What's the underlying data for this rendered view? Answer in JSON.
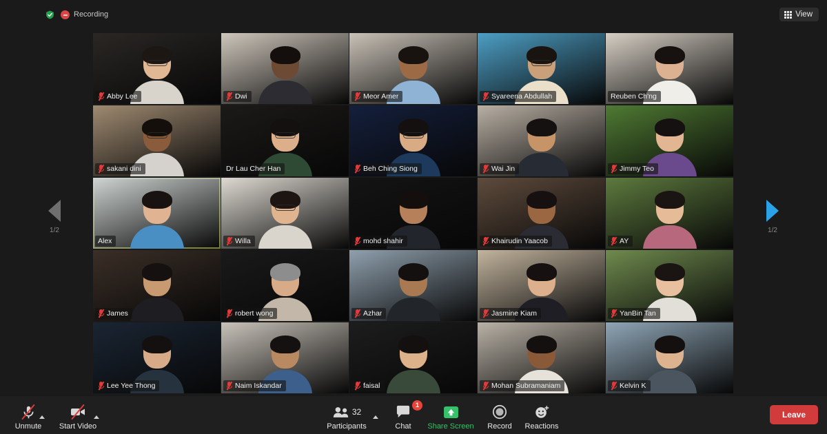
{
  "topbar": {
    "encryption_icon": "shield-check-icon",
    "encryption_color": "#22a04a",
    "recording_icon": "recording-stop-icon",
    "recording_label": "Recording",
    "view_icon": "grid-view-icon",
    "view_label": "View"
  },
  "pagination": {
    "prev_icon": "chevron-left-icon",
    "next_icon": "chevron-right-icon",
    "prev_label": "1/2",
    "next_label": "1/2",
    "prev_color": "#6e6e6e",
    "next_color": "#2ba2e8"
  },
  "gallery": {
    "columns": 5,
    "rows": 5,
    "active_speaker_color": "#d9e65a",
    "participants": [
      {
        "name": "Abby Lee",
        "muted": true,
        "speaking": false,
        "bg": "#2a2724",
        "skin": "#e0b894",
        "hair": "#1d1713",
        "shirt": "#d8d3cb",
        "glasses": true
      },
      {
        "name": "Dwi",
        "muted": true,
        "speaking": false,
        "bg": "#cfc7bc",
        "skin": "#6d4a33",
        "hair": "#140f0c",
        "shirt": "#2c2c32",
        "glasses": false
      },
      {
        "name": "Meor Amer",
        "muted": true,
        "speaking": false,
        "bg": "#c9c2b7",
        "skin": "#9c6b46",
        "hair": "#191310",
        "shirt": "#8fb3d4",
        "glasses": false
      },
      {
        "name": "Syareena Abdullah",
        "muted": true,
        "speaking": false,
        "bg": "#4d9ec4",
        "skin": "#caa07a",
        "hair": "#1a1411",
        "shirt": "#eadfc9",
        "glasses": true
      },
      {
        "name": "Reuben Ch'ng",
        "muted": false,
        "speaking": false,
        "bg": "#d6cfc4",
        "skin": "#dcb191",
        "hair": "#171210",
        "shirt": "#f0eee9",
        "glasses": false
      },
      {
        "name": "sakani dini",
        "muted": true,
        "speaking": false,
        "bg": "#9f8a71",
        "skin": "#8a5c3c",
        "hair": "#140f0b",
        "shirt": "#d5d2cd",
        "glasses": true
      },
      {
        "name": "Dr Lau Cher Han",
        "muted": false,
        "speaking": false,
        "bg": "#1c1a18",
        "skin": "#dcae89",
        "hair": "#151010",
        "shirt": "#2f4a34",
        "glasses": true
      },
      {
        "name": "Beh Ching Siong",
        "muted": true,
        "speaking": false,
        "bg": "#141f3c",
        "skin": "#d8ab85",
        "hair": "#141010",
        "shirt": "#1d3a5c",
        "glasses": true
      },
      {
        "name": "Wai Jin",
        "muted": true,
        "speaking": false,
        "bg": "#b9b0a4",
        "skin": "#c79468",
        "hair": "#151110",
        "shirt": "#272b33",
        "glasses": false
      },
      {
        "name": "Jimmy Teo",
        "muted": true,
        "speaking": false,
        "bg": "#4f7a33",
        "skin": "#e2b692",
        "hair": "#151110",
        "shirt": "#6a4a8c",
        "glasses": false
      },
      {
        "name": "Alex",
        "muted": false,
        "speaking": true,
        "bg": "#cfd5d3",
        "skin": "#e0b492",
        "hair": "#181210",
        "shirt": "#4a8fc4",
        "glasses": false
      },
      {
        "name": "Willa",
        "muted": true,
        "speaking": false,
        "bg": "#dedad2",
        "skin": "#dfb48f",
        "hair": "#1c1512",
        "shirt": "#d9d4cc",
        "glasses": true
      },
      {
        "name": "mohd shahir",
        "muted": true,
        "speaking": false,
        "bg": "#141414",
        "skin": "#b5805a",
        "hair": "#140f0c",
        "shirt": "#22262c",
        "glasses": false
      },
      {
        "name": "Khairudin Yaacob",
        "muted": true,
        "speaking": false,
        "bg": "#5e4b3c",
        "skin": "#9a6742",
        "hair": "#161110",
        "shirt": "#2b2b33",
        "glasses": false
      },
      {
        "name": "AY",
        "muted": true,
        "speaking": false,
        "bg": "#5d7a3e",
        "skin": "#e6bc98",
        "hair": "#1a1412",
        "shirt": "#b8687c",
        "glasses": false
      },
      {
        "name": "James",
        "muted": true,
        "speaking": false,
        "bg": "#3b2f27",
        "skin": "#c79a72",
        "hair": "#151110",
        "shirt": "#1d1d22",
        "glasses": false
      },
      {
        "name": "robert wong",
        "muted": true,
        "speaking": false,
        "bg": "#1a1a1a",
        "skin": "#d8ab88",
        "hair": "#8d8d8d",
        "shirt": "#c2b7a8",
        "glasses": false
      },
      {
        "name": "Azhar",
        "muted": true,
        "speaking": false,
        "bg": "#8fa0ad",
        "skin": "#a97a52",
        "hair": "#141010",
        "shirt": "#22262b",
        "glasses": false
      },
      {
        "name": "Jasmine Kiam",
        "muted": true,
        "speaking": false,
        "bg": "#c2b49e",
        "skin": "#dcb08c",
        "hair": "#161110",
        "shirt": "#1e1e24",
        "glasses": false
      },
      {
        "name": "YanBin Tan",
        "muted": true,
        "speaking": false,
        "bg": "#6f8b4e",
        "skin": "#e8c0a0",
        "hair": "#1a1412",
        "shirt": "#e2dfd8",
        "glasses": false
      },
      {
        "name": "Lee Yee Thong",
        "muted": true,
        "speaking": false,
        "bg": "#1a2533",
        "skin": "#d7ab88",
        "hair": "#141010",
        "shirt": "#26333f",
        "glasses": false
      },
      {
        "name": "Naim Iskandar",
        "muted": true,
        "speaking": false,
        "bg": "#c8c2b9",
        "skin": "#b98a62",
        "hair": "#151110",
        "shirt": "#3d5f8c",
        "glasses": false
      },
      {
        "name": "faisal",
        "muted": true,
        "speaking": false,
        "bg": "#1d1d1d",
        "skin": "#ddb189",
        "hair": "#141010",
        "shirt": "#3a4a3a",
        "glasses": false
      },
      {
        "name": "Mohan Subramaniam",
        "muted": true,
        "speaking": false,
        "bg": "#b9b2a6",
        "skin": "#8a5a38",
        "hair": "#141010",
        "shirt": "#e6e2da",
        "glasses": false
      },
      {
        "name": "Kelvin K",
        "muted": true,
        "speaking": false,
        "bg": "#8fa6b6",
        "skin": "#ddb38f",
        "hair": "#141010",
        "shirt": "#4a5560",
        "glasses": false
      }
    ]
  },
  "toolbar": {
    "mute": {
      "label": "Unmute",
      "icon": "microphone-muted-icon"
    },
    "video": {
      "label": "Start Video",
      "icon": "camera-off-icon"
    },
    "participants": {
      "label": "Participants",
      "icon": "participants-icon",
      "count": "32"
    },
    "chat": {
      "label": "Chat",
      "icon": "chat-bubble-icon",
      "badge": "1"
    },
    "share": {
      "label": "Share Screen",
      "icon": "share-screen-icon",
      "color": "#3cbf6a"
    },
    "record": {
      "label": "Record",
      "icon": "record-circle-icon"
    },
    "reactions": {
      "label": "Reactions",
      "icon": "reactions-smiley-icon"
    },
    "leave": {
      "label": "Leave",
      "color": "#d13b3b"
    }
  }
}
